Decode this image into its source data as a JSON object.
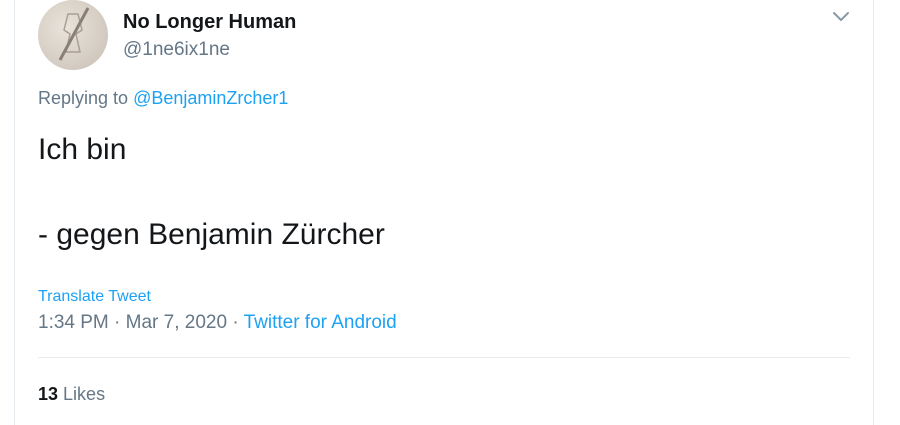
{
  "tweet": {
    "display_name": "No Longer Human",
    "handle": "@1ne6ix1ne",
    "replying_prefix": "Replying to",
    "replying_to": "@BenjaminZrcher1",
    "text_line1": "Ich bin",
    "text_line2": "- gegen Benjamin Zürcher",
    "translate_label": "Translate Tweet",
    "timestamp": "1:34 PM · Mar 7, 2020 · ",
    "source": "Twitter for Android",
    "likes_count": "13",
    "likes_label": "Likes"
  },
  "icons": {
    "more": "chevron-down-icon",
    "avatar": "avatar"
  },
  "colors": {
    "accent": "#1da1f2",
    "secondary_text": "#657786",
    "primary_text": "#14171a",
    "divider": "#e6ecf0"
  }
}
